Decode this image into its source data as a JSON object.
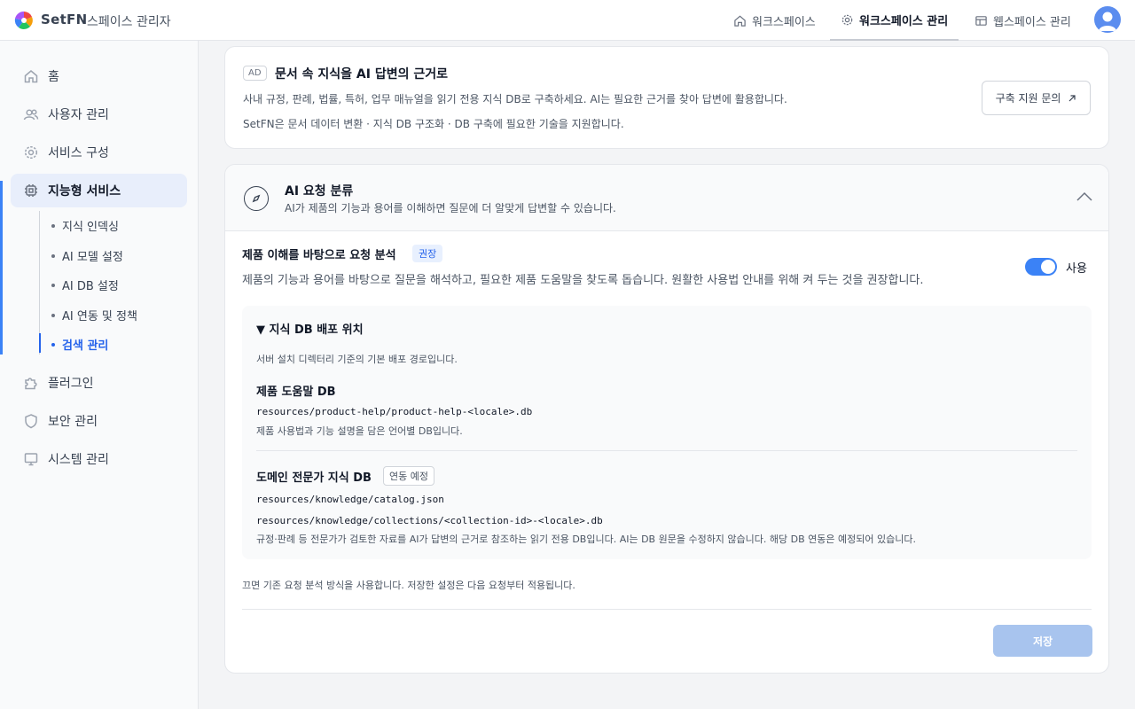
{
  "header": {
    "brand": "SetFN",
    "subtitle": "스페이스 관리자",
    "nav": [
      {
        "label": "워크스페이스",
        "icon": "home-icon"
      },
      {
        "label": "워크스페이스 관리",
        "icon": "gear-icon",
        "active": true
      },
      {
        "label": "웹스페이스 관리",
        "icon": "layout-icon"
      }
    ]
  },
  "sidebar": {
    "items": [
      {
        "label": "홈",
        "icon": "home-icon"
      },
      {
        "label": "사용자 관리",
        "icon": "users-icon"
      },
      {
        "label": "서비스 구성",
        "icon": "gear-icon"
      },
      {
        "label": "지능형 서비스",
        "icon": "chip-icon",
        "active": true
      },
      {
        "label": "플러그인",
        "icon": "puzzle-icon"
      },
      {
        "label": "보안 관리",
        "icon": "shield-icon"
      },
      {
        "label": "시스템 관리",
        "icon": "monitor-icon"
      }
    ],
    "subitems": [
      {
        "label": "지식 인덱싱"
      },
      {
        "label": "AI 모델 설정"
      },
      {
        "label": "AI DB 설정"
      },
      {
        "label": "AI 연동 및 정책"
      },
      {
        "label": "검색 관리",
        "active": true
      }
    ]
  },
  "ad_card": {
    "badge": "AD",
    "title": "문서 속 지식을 AI 답변의 근거로",
    "desc1": "사내 규정, 판례, 법률, 특허, 업무 매뉴얼을 읽기 전용 지식 DB로 구축하세요. AI는 필요한 근거를 찾아 답변에 활용합니다.",
    "desc2": "SetFN은 문서 데이터 변환 · 지식 DB 구조화 · DB 구축에 필요한 기술을 지원합니다.",
    "button": "구축 지원 문의"
  },
  "section": {
    "title": "AI 요청 분류",
    "desc": "AI가 제품의 기능과 용어를 이해하면 질문에 더 알맞게 답변할 수 있습니다.",
    "option": {
      "title": "제품 이해를 바탕으로 요청 분석",
      "badge": "권장",
      "desc": "제품의 기능과 용어를 바탕으로 질문을 해석하고, 필요한 제품 도움말을 찾도록 돕습니다. 원활한 사용법 안내를 위해 켜 두는 것을 권장합니다.",
      "toggle_label": "사용",
      "enabled": true
    },
    "db": {
      "title": "▼ 지식 DB 배포 위치",
      "subtitle": "서버 설치 디렉터리 기준의 기본 배포 경로입니다.",
      "product": {
        "title": "제품 도움말 DB",
        "path": "resources/product-help/product-help-<locale>.db",
        "note": "제품 사용법과 기능 설명을 담은 언어별 DB입니다."
      },
      "domain": {
        "title": "도메인 전문가 지식 DB",
        "badge": "연동 예정",
        "path1": "resources/knowledge/catalog.json",
        "path2": "resources/knowledge/collections/<collection-id>-<locale>.db",
        "note": "규정·판례 등 전문가가 검토한 자료를 AI가 답변의 근거로 참조하는 읽기 전용 DB입니다. AI는 DB 원문을 수정하지 않습니다. 해당 DB 연동은 예정되어 있습니다."
      }
    },
    "off_note": "끄면 기존 요청 분석 방식을 사용합니다. 저장한 설정은 다음 요청부터 적용됩니다.",
    "save": "저장"
  },
  "colors": {
    "accent": "#3b82f6",
    "save_disabled": "#a8c4ee",
    "badge_bg": "#e8f0fe"
  }
}
